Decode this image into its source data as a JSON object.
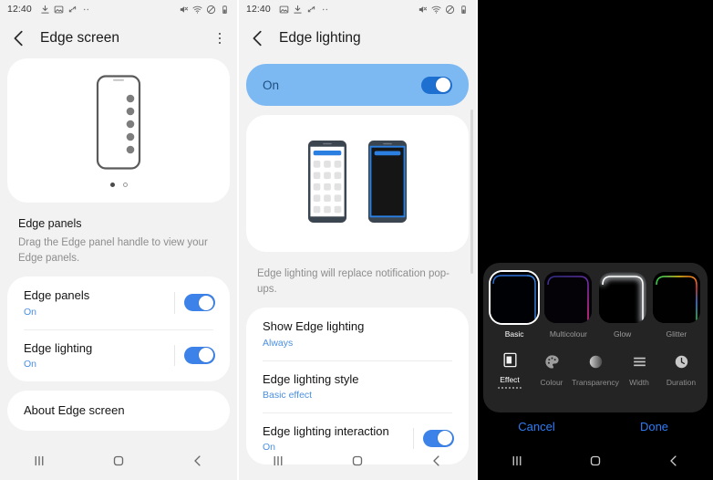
{
  "status_bar": {
    "time": "12:40",
    "left_icons": [
      "download-icon",
      "image-icon",
      "sync-icon",
      "more-dots-icon"
    ],
    "right_icons": [
      "mute-icon",
      "wifi-icon",
      "dnd-icon",
      "battery-icon"
    ]
  },
  "panel1": {
    "title": "Edge screen",
    "back_icon": "back-arrow-icon",
    "overflow_icon": "overflow-menu-icon",
    "hero": {
      "illustration": "edge-panel-phone-illustration",
      "page_dots": [
        true,
        false
      ]
    },
    "section": {
      "heading": "Edge panels",
      "description": "Drag the Edge panel handle to view your Edge panels."
    },
    "rows": [
      {
        "title": "Edge panels",
        "sub": "On",
        "toggle": "on"
      },
      {
        "title": "Edge lighting",
        "sub": "On",
        "toggle": "on"
      }
    ],
    "about": "About Edge screen",
    "nav": [
      "recents-icon",
      "home-icon",
      "back-icon"
    ]
  },
  "panel2": {
    "title": "Edge lighting",
    "back_icon": "back-arrow-icon",
    "master_switch": {
      "label": "On",
      "toggle": "on"
    },
    "preview": {
      "phone_light": "phone-with-app-grid-illustration",
      "phone_dark": "phone-dark-edge-lighting-illustration"
    },
    "description": "Edge lighting will replace notification pop-ups.",
    "rows": [
      {
        "title": "Show Edge lighting",
        "sub": "Always",
        "toggle": null
      },
      {
        "title": "Edge lighting style",
        "sub": "Basic effect",
        "toggle": null
      },
      {
        "title": "Edge lighting interaction",
        "sub": "On",
        "toggle": "on"
      }
    ],
    "nav": [
      "recents-icon",
      "home-icon",
      "back-icon"
    ]
  },
  "panel3": {
    "effects": [
      {
        "label": "Basic",
        "selected": true
      },
      {
        "label": "Multicolour",
        "selected": false
      },
      {
        "label": "Glow",
        "selected": false
      },
      {
        "label": "Glitter",
        "selected": false
      }
    ],
    "tools": [
      {
        "label": "Effect",
        "icon": "effect-icon",
        "selected": true
      },
      {
        "label": "Colour",
        "icon": "palette-icon",
        "selected": false
      },
      {
        "label": "Transparency",
        "icon": "transparency-icon",
        "selected": false
      },
      {
        "label": "Width",
        "icon": "width-lines-icon",
        "selected": false
      },
      {
        "label": "Duration",
        "icon": "clock-icon",
        "selected": false
      }
    ],
    "actions": {
      "cancel": "Cancel",
      "done": "Done"
    },
    "nav": [
      "recents-icon",
      "home-icon",
      "back-icon"
    ]
  },
  "colors": {
    "accent_blue": "#3c82e8",
    "link_blue": "#4b8fe0",
    "action_blue": "#2e7df6",
    "panel_bg": "#f2f2f2",
    "card_bg": "#ffffff",
    "sheet_bg": "#242424"
  }
}
